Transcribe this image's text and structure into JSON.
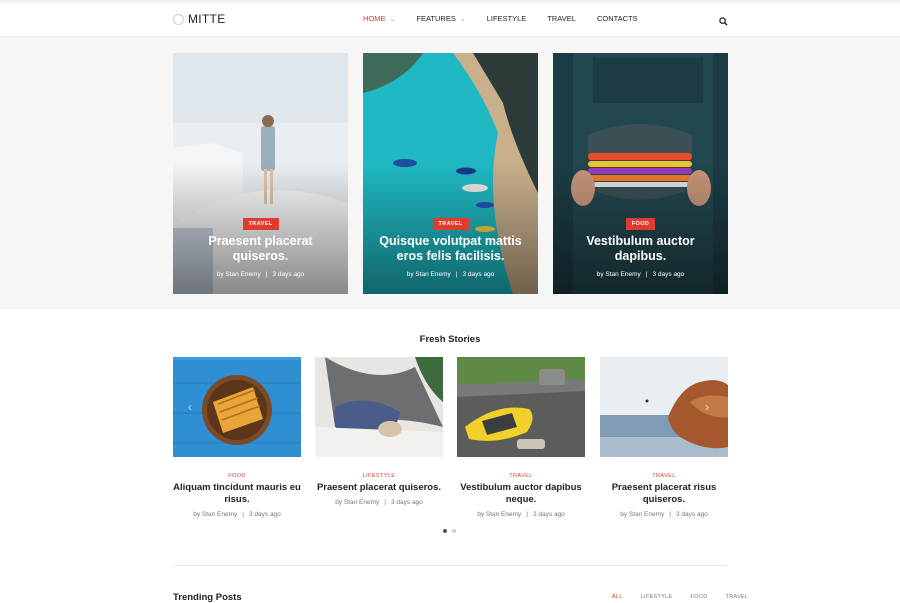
{
  "brand": {
    "name": "MITTE"
  },
  "nav": {
    "items": [
      {
        "label": "HOME",
        "dropdown": true,
        "active": true
      },
      {
        "label": "FEATURES",
        "dropdown": true,
        "active": false
      },
      {
        "label": "LIFESTYLE",
        "dropdown": false,
        "active": false
      },
      {
        "label": "TRAVEL",
        "dropdown": false,
        "active": false
      },
      {
        "label": "CONTACTS",
        "dropdown": false,
        "active": false
      }
    ],
    "search_icon": "search-icon"
  },
  "hero": [
    {
      "category": "TRAVEL",
      "title": "Praesent placerat quiseros.",
      "author": "by Stan Enemy",
      "date": "3 days ago"
    },
    {
      "category": "TRAVEL",
      "title": "Quisque volutpat mattis eros felis facilisis.",
      "author": "by Stan Enemy",
      "date": "3 days ago"
    },
    {
      "category": "FOOD",
      "title": "Vestibulum auctor dapibus.",
      "author": "by Stan Enemy",
      "date": "3 days ago"
    }
  ],
  "fresh": {
    "title": "Fresh Stories",
    "items": [
      {
        "category": "FOOD",
        "title": "Aliquam tincidunt mauris eu risus.",
        "author": "by Stan Enemy",
        "date": "3 days ago"
      },
      {
        "category": "LIFESTYLE",
        "title": "Praesent placerat quiseros.",
        "author": "by Stan Enemy",
        "date": "3 days ago"
      },
      {
        "category": "TRAVEL",
        "title": "Vestibulum auctor dapibus neque.",
        "author": "by Stan Enemy",
        "date": "3 days ago"
      },
      {
        "category": "TRAVEL",
        "title": "Praesent placerat risus quiseros.",
        "author": "by Stan Enemy",
        "date": "3 days ago"
      }
    ],
    "slider_arrows": {
      "prev": "‹",
      "next": "›"
    },
    "pagination": {
      "pages": 2,
      "current": 1
    }
  },
  "trending": {
    "title": "Trending Posts",
    "filters": [
      {
        "label": "ALL",
        "active": true
      },
      {
        "label": "LIFESTYLE",
        "active": false
      },
      {
        "label": "FOOD",
        "active": false
      },
      {
        "label": "TRAVEL",
        "active": false
      }
    ]
  },
  "colors": {
    "accent": "#e03b31",
    "hero_bg": "#f6f6f6"
  }
}
